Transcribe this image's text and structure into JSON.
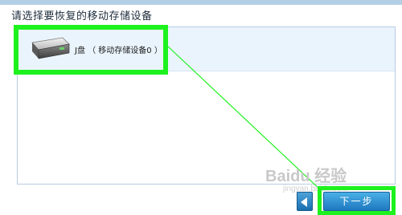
{
  "title": "请选择要恢复的移动存储设备",
  "devices": [
    {
      "label": "J盘 （ 移动存储设备0 ）",
      "icon": "removable-drive-icon"
    }
  ],
  "buttons": {
    "back_icon": "triangle-left-icon",
    "next_label": "下一步"
  },
  "watermark": {
    "main": "Baidu 经验",
    "sub": "jingyan.baidu.com"
  },
  "colors": {
    "highlight": "#1ef21e",
    "button_blue": "#1e78c0",
    "row_selected": "#eaf4fc"
  }
}
